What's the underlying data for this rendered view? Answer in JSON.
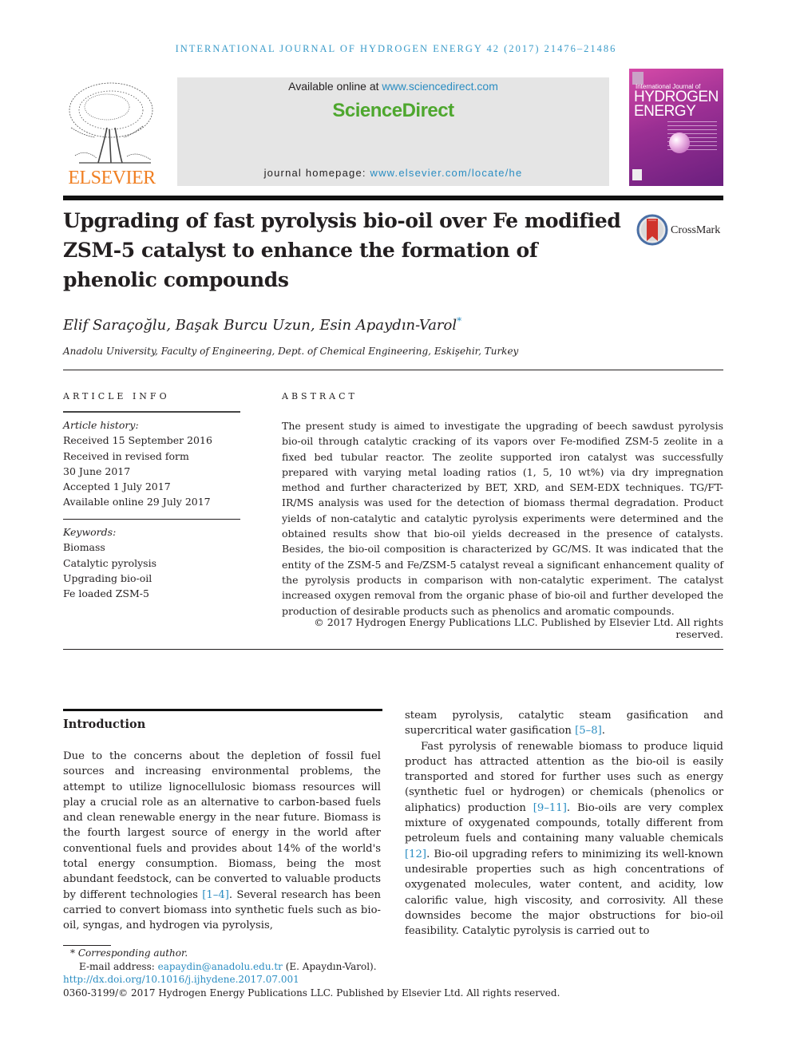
{
  "running_head": "INTERNATIONAL JOURNAL OF HYDROGEN ENERGY 42 (2017) 21476–21486",
  "header": {
    "publisher_logo_text": "ELSEVIER",
    "available_prefix": "Available online at ",
    "available_link": "www.sciencedirect.com",
    "brand": "ScienceDirect",
    "homepage_prefix": "journal homepage: ",
    "homepage_link": "www.elsevier.com/locate/he",
    "cover": {
      "line1": "International Journal of",
      "line2": "HYDROGEN",
      "line3": "ENERGY"
    },
    "colors": {
      "elsevier_orange": "#f07f22",
      "sciencedirect_green": "#4ea72e",
      "link_blue": "#2a8dc2",
      "banner_gray": "#e5e5e5"
    }
  },
  "article": {
    "title": "Upgrading of fast pyrolysis bio-oil over Fe modified ZSM-5 catalyst to enhance the formation of phenolic compounds",
    "title_lines": [
      "Upgrading of fast pyrolysis bio-oil over Fe modified",
      "ZSM-5 catalyst to enhance the formation of",
      "phenolic compounds"
    ],
    "crossmark_label": "CrossMark",
    "authors": "Elif Saraçoğlu, Başak Burcu Uzun, Esin Apaydın-Varol",
    "corresponding_marker": "*",
    "affiliation": "Anadolu University, Faculty of Engineering, Dept. of Chemical Engineering, Eskişehir, Turkey"
  },
  "article_info": {
    "heading": "ARTICLE INFO",
    "history_label": "Article history:",
    "history": [
      "Received 15 September 2016",
      "Received in revised form",
      "30 June 2017",
      "Accepted 1 July 2017",
      "Available online 29 July 2017"
    ],
    "keywords_label": "Keywords:",
    "keywords": [
      "Biomass",
      "Catalytic pyrolysis",
      "Upgrading bio-oil",
      "Fe loaded ZSM-5"
    ]
  },
  "abstract": {
    "heading": "ABSTRACT",
    "text": "The present study is aimed to investigate the upgrading of beech sawdust pyrolysis bio-oil through catalytic cracking of its vapors over Fe-modified ZSM-5 zeolite in a fixed bed tubular reactor. The zeolite supported iron catalyst was successfully prepared with varying metal loading ratios (1, 5, 10 wt%) via dry impregnation method and further characterized by BET, XRD, and SEM-EDX techniques. TG/FT-IR/MS analysis was used for the detection of biomass thermal degradation. Product yields of non-catalytic and catalytic pyrolysis experiments were determined and the obtained results show that bio-oil yields decreased in the presence of catalysts. Besides, the bio-oil composition is characterized by GC/MS. It was indicated that the entity of the ZSM-5 and Fe/ZSM-5 catalyst reveal a significant enhancement quality of the pyrolysis products in comparison with non-catalytic experiment. The catalyst increased oxygen removal from the organic phase of bio-oil and further developed the production of desirable products such as phenolics and aromatic compounds.",
    "copyright": "© 2017 Hydrogen Energy Publications LLC. Published by Elsevier Ltd. All rights reserved."
  },
  "introduction": {
    "heading": "Introduction",
    "col1": {
      "before_ref": "Due to the concerns about the depletion of fossil fuel sources and increasing environmental problems, the attempt to utilize lignocellulosic biomass resources will play a crucial role as an alternative to carbon-based fuels and clean renewable energy in the near future. Biomass is the fourth largest source of energy in the world after conventional fuels and provides about 14% of the world's total energy consumption. Biomass, being the most abundant feedstock, can be converted to valuable products by different technologies ",
      "ref1": "[1–4]",
      "after_ref": ". Several research has been carried to convert biomass into synthetic fuels such as bio-oil, syngas, and hydrogen via pyrolysis,"
    },
    "col2": {
      "p1_before": "steam pyrolysis, catalytic steam gasification and supercritical water gasification ",
      "p1_ref": "[5–8]",
      "p1_after": ".",
      "p2_a": "Fast pyrolysis of renewable biomass to produce liquid product has attracted attention as the bio-oil is easily transported and stored for further uses such as energy (synthetic fuel or hydrogen) or chemicals (phenolics or aliphatics) production ",
      "p2_ref1": "[9–11]",
      "p2_b": ". Bio-oils are very complex mixture of oxygenated compounds, totally different from petroleum fuels and containing many valuable chemicals ",
      "p2_ref2": "[12]",
      "p2_c": ". Bio-oil upgrading refers to minimizing its well-known undesirable properties such as high concentrations of oxygenated molecules, water content, and acidity, low calorific value, high viscosity, and corrosivity. All these downsides become the major obstructions for bio-oil feasibility. Catalytic pyrolysis is carried out to"
    }
  },
  "footnotes": {
    "corresponding": "* Corresponding author.",
    "email_label": "E-mail address: ",
    "email": "eapaydin@anadolu.edu.tr",
    "email_suffix": " (E. Apaydın-Varol).",
    "doi": "http://dx.doi.org/10.1016/j.ijhydene.2017.07.001",
    "issn_copyright": "0360-3199/© 2017 Hydrogen Energy Publications LLC. Published by Elsevier Ltd. All rights reserved."
  }
}
